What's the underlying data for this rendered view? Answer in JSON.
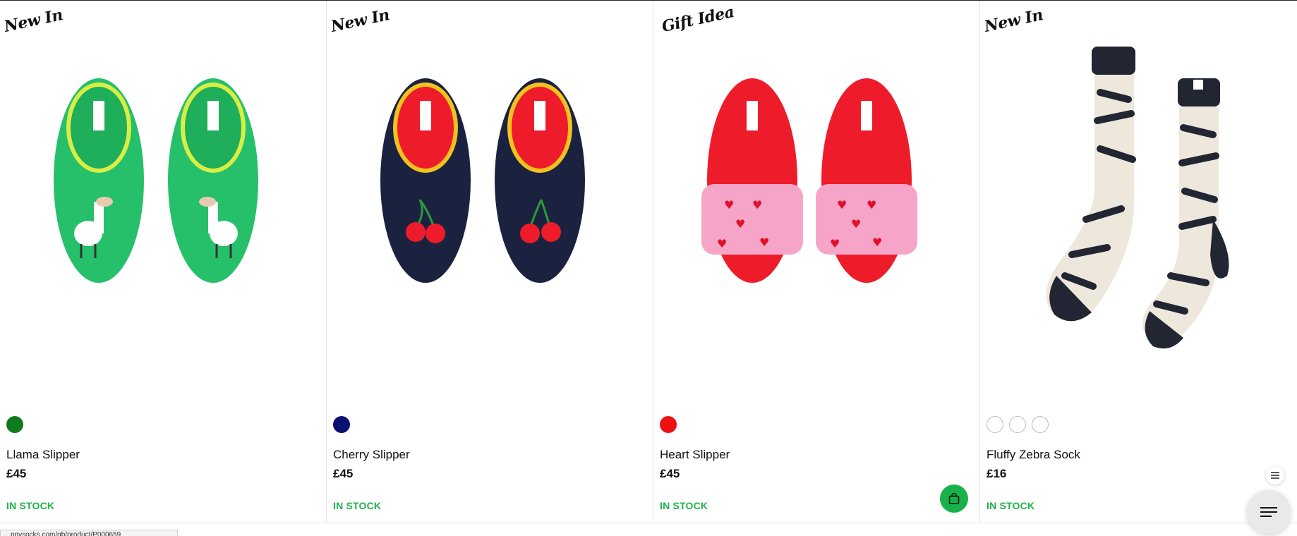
{
  "products": [
    {
      "tag": "New In",
      "name": "Llama Slipper",
      "price": "£45",
      "stock": "IN STOCK",
      "swatches": [
        "#0f7a1e"
      ],
      "image_icon": "llama-slipper-image"
    },
    {
      "tag": "New In",
      "name": "Cherry Slipper",
      "price": "£45",
      "stock": "IN STOCK",
      "swatches": [
        "#0a1070"
      ],
      "image_icon": "cherry-slipper-image"
    },
    {
      "tag": "Gift Idea",
      "name": "Heart Slipper",
      "price": "£45",
      "stock": "IN STOCK",
      "swatches": [
        "#ee1111"
      ],
      "image_icon": "heart-slipper-image"
    },
    {
      "tag": "New In",
      "name": "Fluffy Zebra Sock",
      "price": "£16",
      "stock": "IN STOCK",
      "swatches": [
        "#ffffff",
        "#ffffff",
        "#ffffff"
      ],
      "image_icon": "zebra-sock-image"
    }
  ],
  "status_bar": {
    "url": "…ppysocks.com/gb/product/P000659"
  },
  "colors": {
    "in_stock": "#1eb34a",
    "bag_button": "#17b34a"
  },
  "icons": {
    "bag": "shopping-bag-icon",
    "menu": "menu-icon",
    "list": "list-icon"
  }
}
